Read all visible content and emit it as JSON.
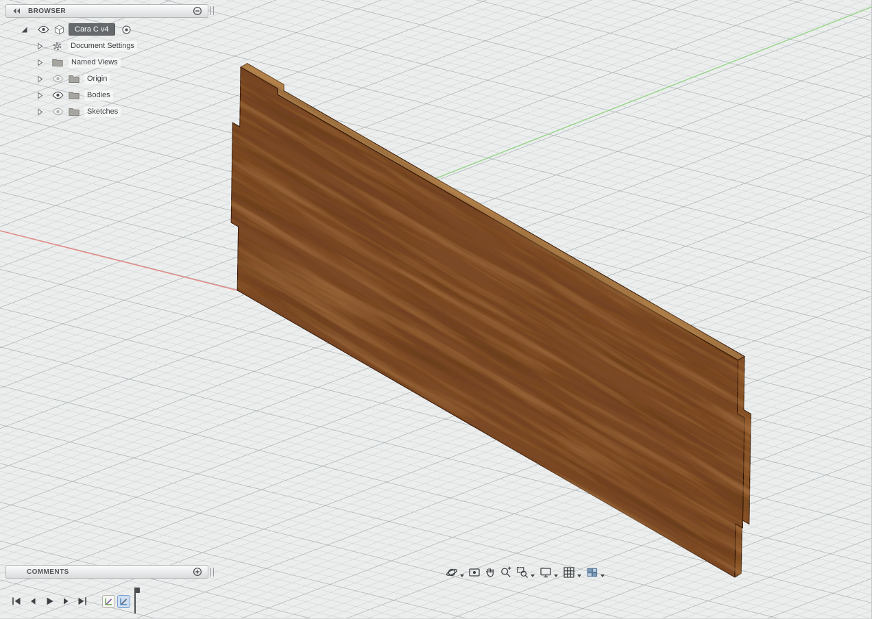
{
  "browser": {
    "title": "BROWSER",
    "document": {
      "label": "Cara C v4"
    },
    "items": [
      {
        "label": "Document Settings",
        "icon": "gear",
        "visibility": "none"
      },
      {
        "label": "Named Views",
        "icon": "folder",
        "visibility": "none"
      },
      {
        "label": "Origin",
        "icon": "folder",
        "visibility": "off"
      },
      {
        "label": "Bodies",
        "icon": "folder",
        "visibility": "on"
      },
      {
        "label": "Sketches",
        "icon": "folder",
        "visibility": "off"
      }
    ]
  },
  "comments": {
    "title": "COMMENTS"
  },
  "navbar": {
    "tools": [
      "orbit",
      "look-at",
      "pan",
      "zoom",
      "zoom-window",
      "display-settings",
      "grid-and-snaps",
      "viewports"
    ]
  },
  "timeline": {
    "controls": [
      "go-to-start",
      "step-back",
      "play",
      "step-forward",
      "go-to-end"
    ],
    "features": [
      {
        "name": "sketch-feature-1",
        "selected": false
      },
      {
        "name": "sketch-feature-2",
        "selected": true
      }
    ]
  },
  "canvas": {
    "background": "#eceeee",
    "axes": {
      "x_color": "#e8837a",
      "y_color": "#90d380"
    },
    "wood": {
      "front": "#7b4a26",
      "top": "#a87a47",
      "end": "#8a552c",
      "outline": "#2b1709"
    }
  }
}
